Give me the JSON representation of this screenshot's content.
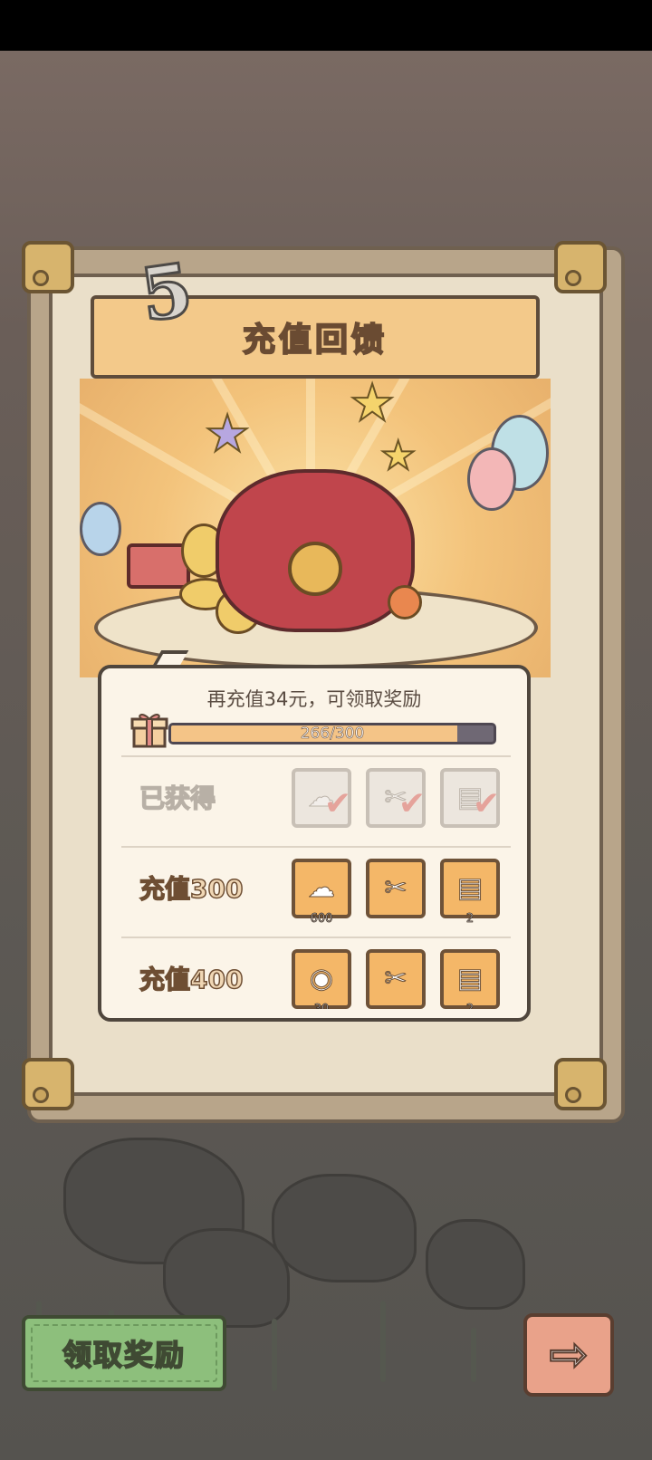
{
  "header": {
    "level_number": "5",
    "title": "充值回馈"
  },
  "progress": {
    "hint": "再充值34元，可领取奖励",
    "current": 266,
    "target": 300,
    "text": "266/300",
    "fraction": 0.887
  },
  "tiers": [
    {
      "label": "已获得",
      "status": "obtained",
      "rewards": [
        {
          "icon": "ghost-soul-icon",
          "quantity": ""
        },
        {
          "icon": "scissors-tool-icon",
          "quantity": ""
        },
        {
          "icon": "ticket-bundle-icon",
          "quantity": ""
        }
      ]
    },
    {
      "label": "充值300",
      "status": "available",
      "rewards": [
        {
          "icon": "ghost-soul-icon",
          "quantity": "600"
        },
        {
          "icon": "scissors-tool-icon",
          "quantity": ""
        },
        {
          "icon": "ticket-bundle-icon",
          "quantity": "2"
        }
      ]
    },
    {
      "label": "充值400",
      "status": "locked",
      "rewards": [
        {
          "icon": "gold-medal-icon",
          "quantity": "30"
        },
        {
          "icon": "scissors-tool-icon",
          "quantity": ""
        },
        {
          "icon": "ticket-bundle-icon",
          "quantity": "2"
        }
      ]
    }
  ],
  "buttons": {
    "claim_label": "领取奖励",
    "next_icon": "arrow-right-icon"
  },
  "colors": {
    "claim_button": "#8dbf7c",
    "next_button": "#e9a28a",
    "reward_tile": "#f4b768",
    "progress_fill": "#f4c487",
    "progress_track": "#6f6874"
  }
}
